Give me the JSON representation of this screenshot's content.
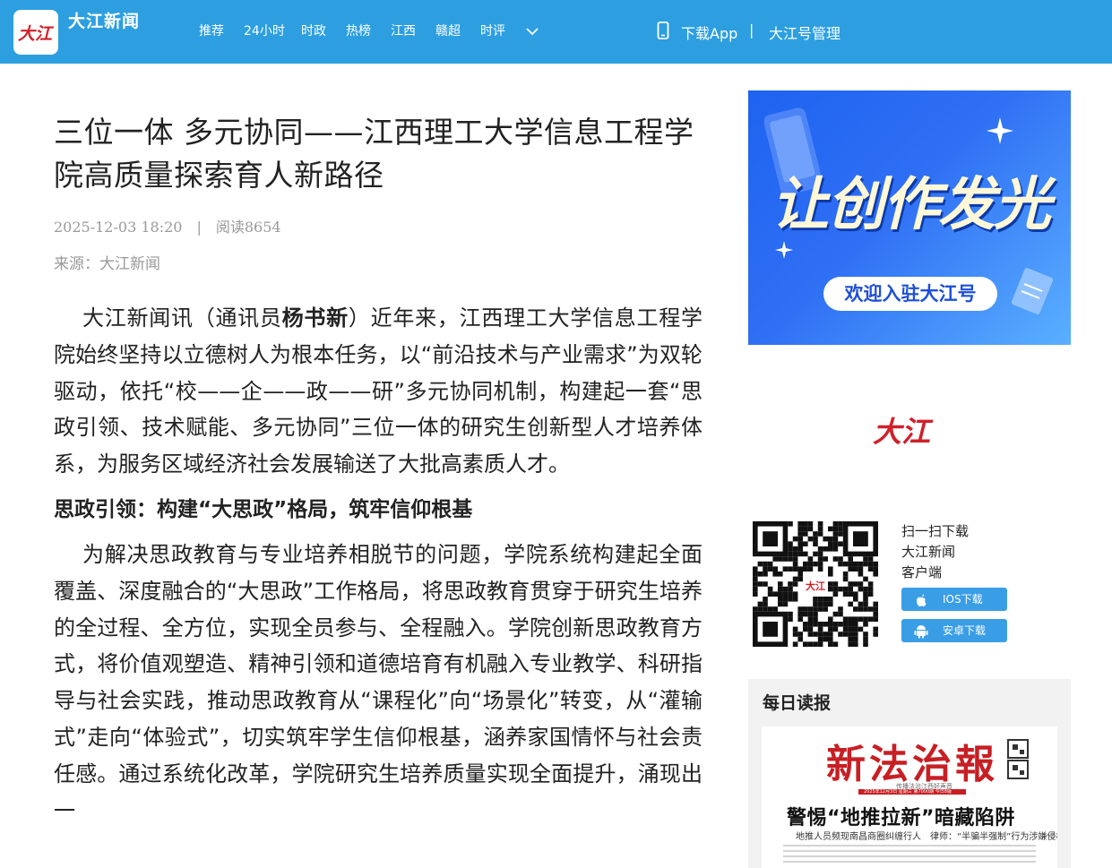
{
  "header": {
    "logo_text": "大江",
    "site_name": "大江新闻",
    "nav": [
      "推荐",
      "24小时",
      "时政",
      "热榜",
      "江西",
      "赣超",
      "时评"
    ],
    "download_app": "下载App",
    "separator": "|",
    "account_manage": "大江号管理",
    "bg_color": "#2d9fe0"
  },
  "article": {
    "title": "三位一体 多元协同——江西理工大学信息工程学院高质量探索育人新路径",
    "date": "2025-12-03 18:20",
    "meta_separator": "|",
    "reads": "阅读8654",
    "source": "来源：大江新闻",
    "p1_prefix": "大江新闻讯（通讯员",
    "p1_author": "杨书新",
    "p1_text": "）近年来，江西理工大学信息工程学院始终坚持以立德树人为根本任务，以“前沿技术与产业需求”为双轮驱动，依托“校——企——政——研”多元协同机制，构建起一套“思政引领、技术赋能、多元协同”三位一体的研究生创新型人才培养体系，为服务区域经济社会发展输送了大批高素质人才。",
    "subhead1": "思政引领：构建“大思政”格局，筑牢信仰根基",
    "p2": "为解决思政教育与专业培养相脱节的问题，学院系统构建起全面覆盖、深度融合的“大思政”工作格局，将思政教育贯穿于研究生培养的全过程、全方位，实现全员参与、全程融入。学院创新思政教育方式，将价值观塑造、精神引领和道德培育有机融入专业教学、科研指导与社会实践，推动思政教育从“课程化”向“场景化”转变，从“灌输式”走向“体验式”，切实筑牢学生信仰根基，涵养家国情怀与社会责任感。通过系统化改革，学院研究生培养质量实现全面提升，涌现出一"
  },
  "sidebar": {
    "banner_headline": "让创作发光",
    "banner_button": "欢迎入驻大江号",
    "brand_logo_text": "大江",
    "qr_line1": "扫一扫下载",
    "qr_line2": "大江新闻",
    "qr_line3": "客户端",
    "ios_download": "IOS下载",
    "android_download": "安卓下载",
    "daily_title": "每日读报",
    "newspaper": {
      "masthead": "新法治報",
      "tagline": "传播法治江西好声音",
      "stripe_text": "2025年12月3日 星期三 第7000期 今日8版",
      "headline": "警惕“地推拉新”暗藏陷阱",
      "deck": "地推人员频现南昌商圈纠缠行人　律师：“半骗半强制”行为涉嫌侵权"
    }
  }
}
